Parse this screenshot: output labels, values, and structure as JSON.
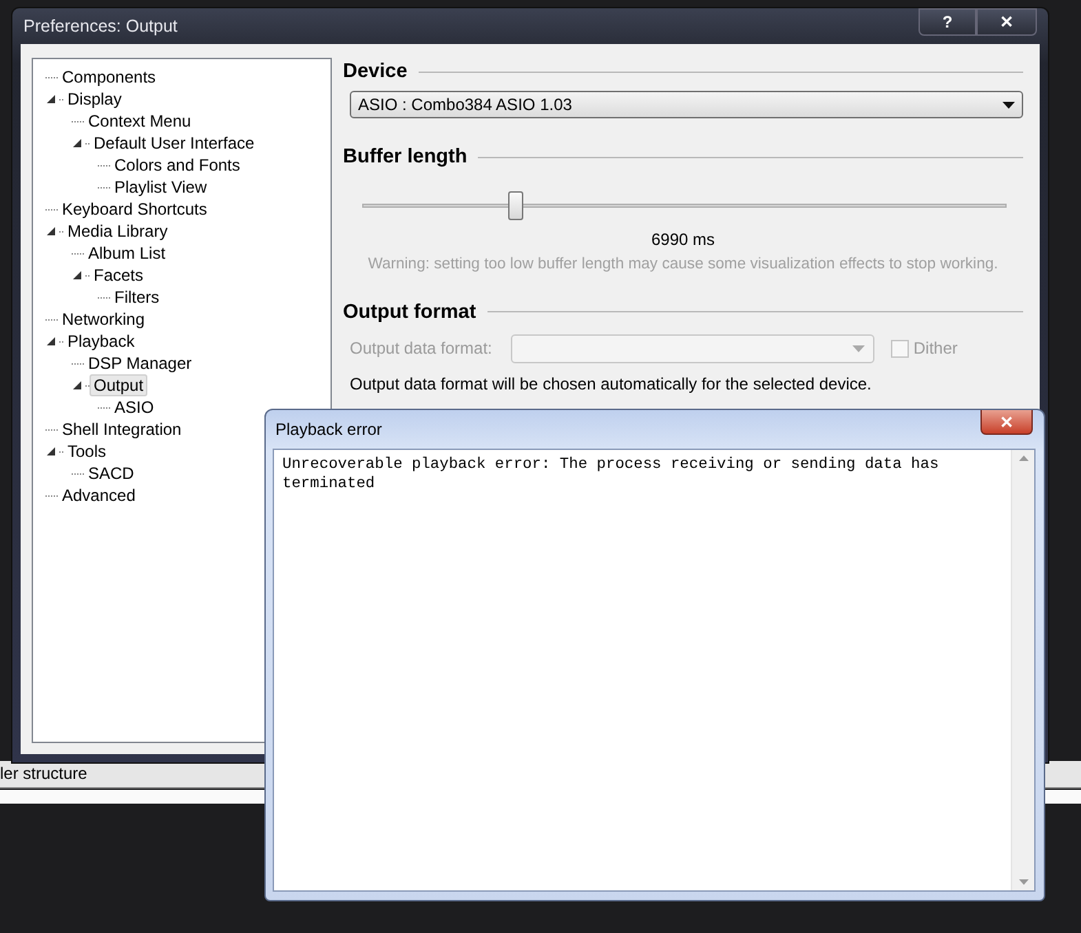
{
  "background": {
    "status_text": "ler structure"
  },
  "preferences_window": {
    "title": "Preferences: Output",
    "title_buttons": [
      {
        "label": "?"
      },
      {
        "label": "✕"
      }
    ],
    "tree": [
      {
        "label": "Components",
        "selected": false
      },
      {
        "label": "Display",
        "selected": false,
        "expanded": true,
        "children": [
          {
            "label": "Context Menu",
            "selected": false
          },
          {
            "label": "Default User Interface",
            "selected": false,
            "expanded": true,
            "children": [
              {
                "label": "Colors and Fonts",
                "selected": false
              },
              {
                "label": "Playlist View",
                "selected": false
              }
            ]
          }
        ]
      },
      {
        "label": "Keyboard Shortcuts",
        "selected": false
      },
      {
        "label": "Media Library",
        "selected": false,
        "expanded": true,
        "children": [
          {
            "label": "Album List",
            "selected": false
          },
          {
            "label": "Facets",
            "selected": false,
            "expanded": true,
            "children": [
              {
                "label": "Filters",
                "selected": false
              }
            ]
          }
        ]
      },
      {
        "label": "Networking",
        "selected": false
      },
      {
        "label": "Playback",
        "selected": false,
        "expanded": true,
        "children": [
          {
            "label": "DSP Manager",
            "selected": false
          },
          {
            "label": "Output",
            "selected": true,
            "expanded": true,
            "children": [
              {
                "label": "ASIO",
                "selected": false
              }
            ]
          }
        ]
      },
      {
        "label": "Shell Integration",
        "selected": false
      },
      {
        "label": "Tools",
        "selected": false,
        "expanded": true,
        "children": [
          {
            "label": "SACD",
            "selected": false
          }
        ]
      },
      {
        "label": "Advanced",
        "selected": false
      }
    ],
    "device": {
      "heading": "Device",
      "value": "ASIO : Combo384 ASIO 1.03"
    },
    "buffer_length": {
      "heading": "Buffer length",
      "level": 0.237,
      "reading": "6990 ms",
      "warning": "Warning: setting too low buffer length may cause some visualization effects to stop working."
    },
    "output_format": {
      "heading": "Output format",
      "format_label": "Output data format:",
      "format_disabled": true,
      "dither": {
        "label": "Dither",
        "checked": false,
        "disabled": true
      },
      "note": "Output data format will be chosen automatically for the selected device."
    }
  },
  "error_dialog": {
    "title": "Playback error",
    "close_label": "✕",
    "message": "Unrecoverable playback error: The process receiving or sending data has terminated"
  }
}
